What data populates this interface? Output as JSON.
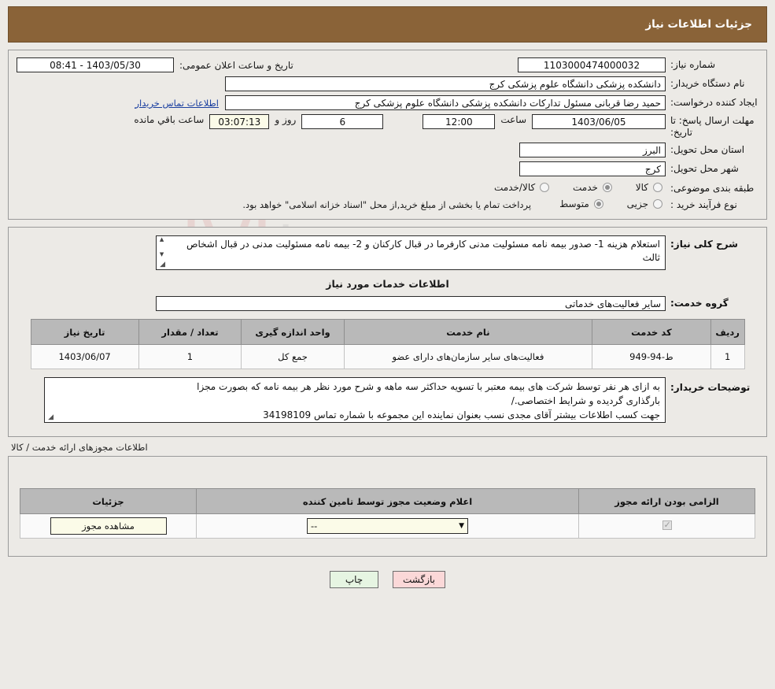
{
  "header": {
    "title": "جزئیات اطلاعات نیاز"
  },
  "need": {
    "number_label": "شماره نیاز:",
    "number_value": "1103000474000032",
    "announce_label": "تاریخ و ساعت اعلان عمومی:",
    "announce_value": "1403/05/30 - 08:41",
    "buyer_org_label": "نام دستگاه خریدار:",
    "buyer_org_value": "دانشکده پزشکی دانشگاه علوم پزشکی کرج",
    "creator_label": "ایجاد کننده درخواست:",
    "creator_value": "حمید رضا قربانی مسئول تدارکات دانشکده پزشکی دانشگاه علوم پزشکی کرج",
    "contact_link": "اطلاعات تماس خریدار",
    "deadline_label": "مهلت ارسال پاسخ: تا تاریخ:",
    "deadline_date": "1403/06/05",
    "hour_label": "ساعت",
    "deadline_time": "12:00",
    "days_value": "6",
    "days_label": "روز و",
    "remaining_time": "03:07:13",
    "remaining_label": "ساعت باقي مانده",
    "province_label": "استان محل تحویل:",
    "province_value": "البرز",
    "city_label": "شهر محل تحویل:",
    "city_value": "کرج",
    "category_label": "طبقه بندی موضوعی:",
    "category_options": [
      {
        "label": "کالا",
        "selected": false
      },
      {
        "label": "خدمت",
        "selected": true
      },
      {
        "label": "کالا/خدمت",
        "selected": false
      }
    ],
    "process_label": "نوع فرآیند خرید :",
    "process_options": [
      {
        "label": "جزیی",
        "selected": false
      },
      {
        "label": "متوسط",
        "selected": true
      }
    ],
    "payment_note": "پرداخت تمام یا بخشی از مبلغ خرید,از محل \"اسناد خزانه اسلامی\" خواهد بود."
  },
  "description": {
    "label": "شرح کلی نیاز:",
    "value": "استعلام هزینه 1- صدور بیمه نامه مسئولیت مدنی کارفرما در قبال کارکنان و 2- بیمه نامه مسئولیت مدنی در قبال اشخاص ثالث"
  },
  "services": {
    "section_title": "اطلاعات خدمات مورد نیاز",
    "group_label": "گروه خدمت:",
    "group_value": "سایر فعالیت‌های خدماتی",
    "columns": [
      "ردیف",
      "کد خدمت",
      "نام خدمت",
      "واحد اندازه گیری",
      "تعداد / مقدار",
      "تاریخ نیاز"
    ],
    "rows": [
      {
        "row": "1",
        "code": "ط-94-949",
        "name": "فعالیت‌های سایر سازمان‌های دارای عضو",
        "unit": "جمع کل",
        "qty": "1",
        "date": "1403/06/07"
      }
    ]
  },
  "buyer_notes": {
    "label": "توضیحات خریدار:",
    "lines": [
      "به ازای هر نفر توسط شرکت های بیمه معتبر با تسویه حداکثر سه ماهه و شرح مورد نظر هر بیمه نامه که بصورت مجزا",
      "بارگذاری گردیده و شرایط اختصاصی./",
      "جهت کسب اطلاعات بیشتر  آقای مجدی نسب بعنوان نماینده این مجموعه با شماره تماس 34198109"
    ]
  },
  "licenses": {
    "section_note": "اطلاعات مجوزهای ارائه خدمت / کالا",
    "columns": [
      "الزامی بودن ارائه مجوز",
      "اعلام وضعیت مجوز توسط تامین کننده",
      "جزئیات"
    ],
    "rows": [
      {
        "required": true,
        "status": "--",
        "details_button": "مشاهده مجوز"
      }
    ]
  },
  "footer": {
    "print": "چاپ",
    "back": "بازگشت"
  }
}
